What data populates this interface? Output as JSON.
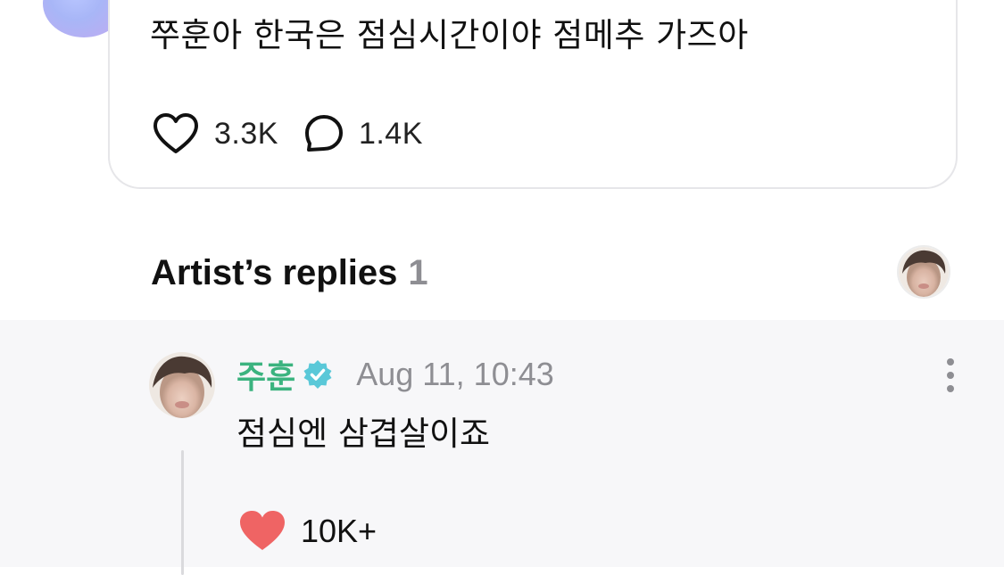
{
  "post": {
    "text": "쭈훈아 한국은 점심시간이야 점메추 가즈아",
    "likes": "3.3K",
    "comments": "1.4K"
  },
  "replies_header": {
    "title": "Artist’s replies",
    "count": "1"
  },
  "reply": {
    "author": "주훈",
    "timestamp": "Aug 11, 10:43",
    "text": "점심엔 삼겹살이죠",
    "likes": "10K+",
    "verified": true
  },
  "colors": {
    "author_green": "#3bb37f",
    "verified_badge": "#5ac8d8",
    "liked_heart": "#ef6464",
    "muted_gray": "#8e8e93",
    "reply_background": "#f7f7f9"
  },
  "icons": {
    "like": "heart-outline-icon",
    "comment": "speech-bubble-icon",
    "verified": "verified-badge-icon",
    "more": "more-vertical-icon",
    "reply_like": "heart-filled-icon"
  }
}
